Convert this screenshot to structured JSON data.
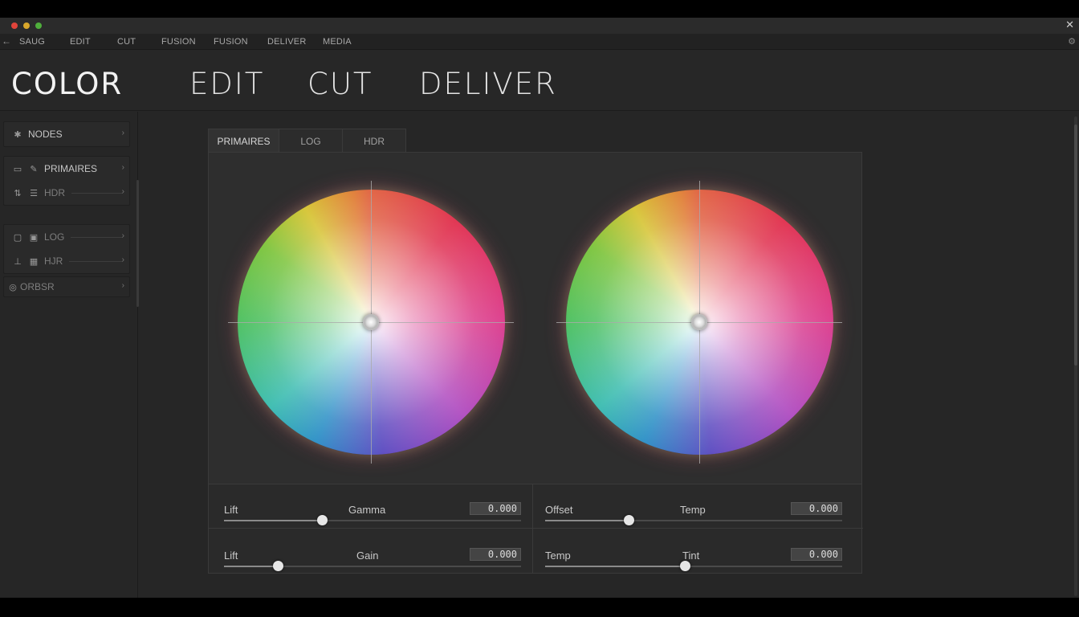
{
  "window": {
    "close_glyph": "✕"
  },
  "menubar": {
    "back_glyph": "←",
    "items": [
      "SAUG",
      "EDIT",
      "CUT",
      "FUSION",
      "FUSION",
      "DELIVER",
      "MEDIA"
    ],
    "right_glyph": "⚙"
  },
  "pages": {
    "items": [
      "COLOR",
      "EDIT",
      "CUT",
      "DELIVER"
    ],
    "active": "COLOR"
  },
  "sidebar": {
    "groups": [
      {
        "items": [
          {
            "label": "NODES",
            "icon": "nodes-icon",
            "glyph": "✱"
          }
        ]
      },
      {
        "items": [
          {
            "label": "PRIMAIRES",
            "icon": "pencil-icon",
            "glyph": "✎",
            "glyph2": "▭"
          },
          {
            "label": "HDR",
            "icon": "sliders-icon",
            "glyph": "☰",
            "glyph2": "⇅"
          }
        ]
      },
      {
        "items": [
          {
            "label": "LOG",
            "icon": "scope-icon",
            "glyph": "▣",
            "glyph2": "▢"
          },
          {
            "label": "HJR",
            "icon": "grid-icon",
            "glyph": "▦",
            "glyph2": "⊥"
          }
        ]
      },
      {
        "items": [
          {
            "label": "ORBSR",
            "icon": "orbit-icon",
            "glyph": "◎"
          }
        ]
      }
    ],
    "chevron": "›"
  },
  "tabs": [
    "PRIMAIRES",
    "LOG",
    "HDR"
  ],
  "active_tab": "PRIMAIRES",
  "controls": [
    {
      "label1": "Lift",
      "label2": "Gamma",
      "value": "0.000",
      "level": 0.33
    },
    {
      "label1": "Offset",
      "label2": "Temp",
      "value": "0.000",
      "level": 0.28
    },
    {
      "label1": "Lift",
      "label2": "Gain",
      "value": "0.000",
      "level": 0.18
    },
    {
      "label1": "Temp",
      "label2": "Tint",
      "value": "0.000",
      "level": 0.47
    }
  ]
}
